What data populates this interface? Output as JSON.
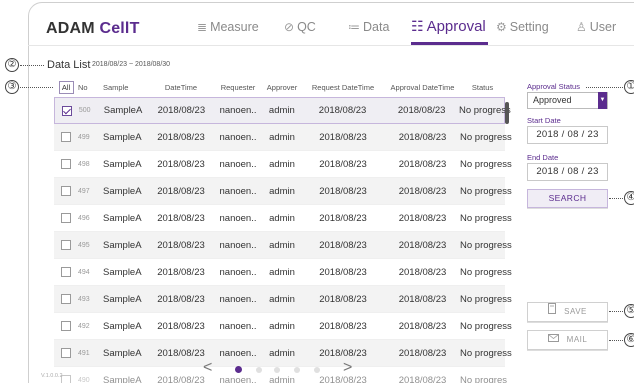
{
  "app": {
    "logo_main": "ADAM ",
    "logo_accent": "CellT"
  },
  "nav": [
    {
      "label": "Measure",
      "icon": "≣"
    },
    {
      "label": "QC",
      "icon": "⊘"
    },
    {
      "label": "Data",
      "icon": "≔"
    },
    {
      "label": "Approval",
      "icon": "☷"
    },
    {
      "label": "Setting",
      "icon": "⚙"
    },
    {
      "label": "User",
      "icon": "♙"
    }
  ],
  "callouts": [
    "①",
    "②",
    "③",
    "④",
    "⑤",
    "⑥"
  ],
  "datalist": {
    "title": "Data List",
    "range": "2018/08/23 ~ 2018/08/30"
  },
  "table": {
    "headers": {
      "all": "All",
      "no": "No",
      "sample": "Sample",
      "datetime": "DateTime",
      "requester": "Requester",
      "approver": "Approver",
      "request_datetime": "Request DateTime",
      "approval_datetime": "Approval DateTime",
      "status": "Status"
    },
    "rows": [
      {
        "no": "500",
        "sample": "SampleA",
        "datetime": "2018/08/23",
        "requester": "nanoen..",
        "approver": "admin",
        "request_datetime": "2018/08/23",
        "approval_datetime": "2018/08/23",
        "status": "No progress"
      },
      {
        "no": "499",
        "sample": "SampleA",
        "datetime": "2018/08/23",
        "requester": "nanoen..",
        "approver": "admin",
        "request_datetime": "2018/08/23",
        "approval_datetime": "2018/08/23",
        "status": "No progress"
      },
      {
        "no": "498",
        "sample": "SampleA",
        "datetime": "2018/08/23",
        "requester": "nanoen..",
        "approver": "admin",
        "request_datetime": "2018/08/23",
        "approval_datetime": "2018/08/23",
        "status": "No progress"
      },
      {
        "no": "497",
        "sample": "SampleA",
        "datetime": "2018/08/23",
        "requester": "nanoen..",
        "approver": "admin",
        "request_datetime": "2018/08/23",
        "approval_datetime": "2018/08/23",
        "status": "No progress"
      },
      {
        "no": "496",
        "sample": "SampleA",
        "datetime": "2018/08/23",
        "requester": "nanoen..",
        "approver": "admin",
        "request_datetime": "2018/08/23",
        "approval_datetime": "2018/08/23",
        "status": "No progress"
      },
      {
        "no": "495",
        "sample": "SampleA",
        "datetime": "2018/08/23",
        "requester": "nanoen..",
        "approver": "admin",
        "request_datetime": "2018/08/23",
        "approval_datetime": "2018/08/23",
        "status": "No progress"
      },
      {
        "no": "494",
        "sample": "SampleA",
        "datetime": "2018/08/23",
        "requester": "nanoen..",
        "approver": "admin",
        "request_datetime": "2018/08/23",
        "approval_datetime": "2018/08/23",
        "status": "No progress"
      },
      {
        "no": "493",
        "sample": "SampleA",
        "datetime": "2018/08/23",
        "requester": "nanoen..",
        "approver": "admin",
        "request_datetime": "2018/08/23",
        "approval_datetime": "2018/08/23",
        "status": "No progress"
      },
      {
        "no": "492",
        "sample": "SampleA",
        "datetime": "2018/08/23",
        "requester": "nanoen..",
        "approver": "admin",
        "request_datetime": "2018/08/23",
        "approval_datetime": "2018/08/23",
        "status": "No progress"
      },
      {
        "no": "491",
        "sample": "SampleA",
        "datetime": "2018/08/23",
        "requester": "nanoen..",
        "approver": "admin",
        "request_datetime": "2018/08/23",
        "approval_datetime": "2018/08/23",
        "status": "No progress"
      },
      {
        "no": "490",
        "sample": "SampleA",
        "datetime": "2018/08/23",
        "requester": "nanoen..",
        "approver": "admin",
        "request_datetime": "2018/08/23",
        "approval_datetime": "2018/08/23",
        "status": "No progres"
      }
    ]
  },
  "pager": {
    "prev": "<",
    "next": ">"
  },
  "version": "V.1.0.0.2",
  "sidebar": {
    "approval_status_label": "Approval Status",
    "approval_status_value": "Approved",
    "start_date_label": "Start Date",
    "start_date_value": "2018 / 08 / 23",
    "end_date_label": "End Date",
    "end_date_value": "2018 / 08 / 23",
    "search_label": "SEARCH",
    "save_label": "SAVE",
    "mail_label": "MAIL"
  },
  "colors": {
    "accent": "#5b2c8e",
    "row_alt": "#f3f3f3"
  }
}
